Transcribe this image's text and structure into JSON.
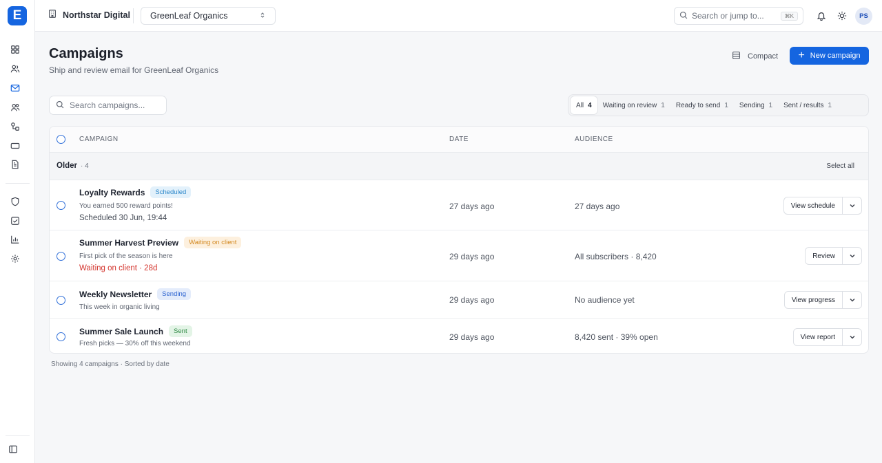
{
  "app": {
    "logo_letter": "E",
    "org_name": "Northstar Digital",
    "client": "GreenLeaf Organics"
  },
  "topbar": {
    "search_placeholder": "Search or jump to...",
    "search_shortcut": "⌘K",
    "user_initials": "PS"
  },
  "sidebar": {
    "items": [
      {
        "name": "dashboard-icon"
      },
      {
        "name": "users-icon"
      },
      {
        "name": "mail-icon",
        "active": true
      },
      {
        "name": "contacts-icon"
      },
      {
        "name": "flows-icon"
      },
      {
        "name": "billing-icon"
      },
      {
        "name": "document-icon"
      },
      {
        "name": "shield-icon"
      },
      {
        "name": "checklist-icon"
      },
      {
        "name": "bar-chart-icon"
      },
      {
        "name": "settings-icon"
      }
    ]
  },
  "page": {
    "title": "Campaigns",
    "subtitle": "Ship and review email for GreenLeaf Organics",
    "compact_label": "Compact",
    "new_button": "New campaign",
    "search_placeholder": "Search campaigns..."
  },
  "filters": [
    {
      "label": "All",
      "count": "4",
      "active": true
    },
    {
      "label": "Waiting on review",
      "count": "1"
    },
    {
      "label": "Ready to send",
      "count": "1"
    },
    {
      "label": "Sending",
      "count": "1"
    },
    {
      "label": "Sent / results",
      "count": "1"
    }
  ],
  "table": {
    "columns": {
      "campaign": "CAMPAIGN",
      "date": "DATE",
      "audience": "AUDIENCE"
    },
    "group": {
      "title": "Older",
      "count": "· 4",
      "select_all": "Select all"
    },
    "rows": [
      {
        "name": "Loyalty Rewards",
        "badge": "Scheduled",
        "desc": "You earned 500 reward points!",
        "note": "Scheduled 30 Jun, 19:44",
        "date": "27 days ago",
        "audience": "27 days ago",
        "action": "View schedule"
      },
      {
        "name": "Summer Harvest Preview",
        "badge": "Waiting on client",
        "desc": "First pick of the season is here",
        "note": "Waiting on client · 28d",
        "date": "29 days ago",
        "audience": "All subscribers · 8,420",
        "action": "Review"
      },
      {
        "name": "Weekly Newsletter",
        "badge": "Sending",
        "desc": "This week in organic living",
        "date": "29 days ago",
        "audience": "No audience yet",
        "action": "View progress"
      },
      {
        "name": "Summer Sale Launch",
        "badge": "Sent",
        "desc": "Fresh picks — 30% off this weekend",
        "date": "29 days ago",
        "audience": "8,420 sent · 39% open",
        "action": "View report"
      }
    ],
    "footer": "Showing 4 campaigns · Sorted by date"
  },
  "colors": {
    "accent": "#1565e0",
    "badge_scheduled_bg": "#e3f1fb",
    "badge_scheduled_fg": "#2a86c9",
    "badge_waiting_bg": "#fdf0de",
    "badge_waiting_fg": "#d38a23",
    "badge_sending_bg": "#e4ecfb",
    "badge_sending_fg": "#2c63d0",
    "badge_sent_bg": "#e3f4e6",
    "badge_sent_fg": "#2f8a45",
    "warn_text": "#d4362f"
  }
}
